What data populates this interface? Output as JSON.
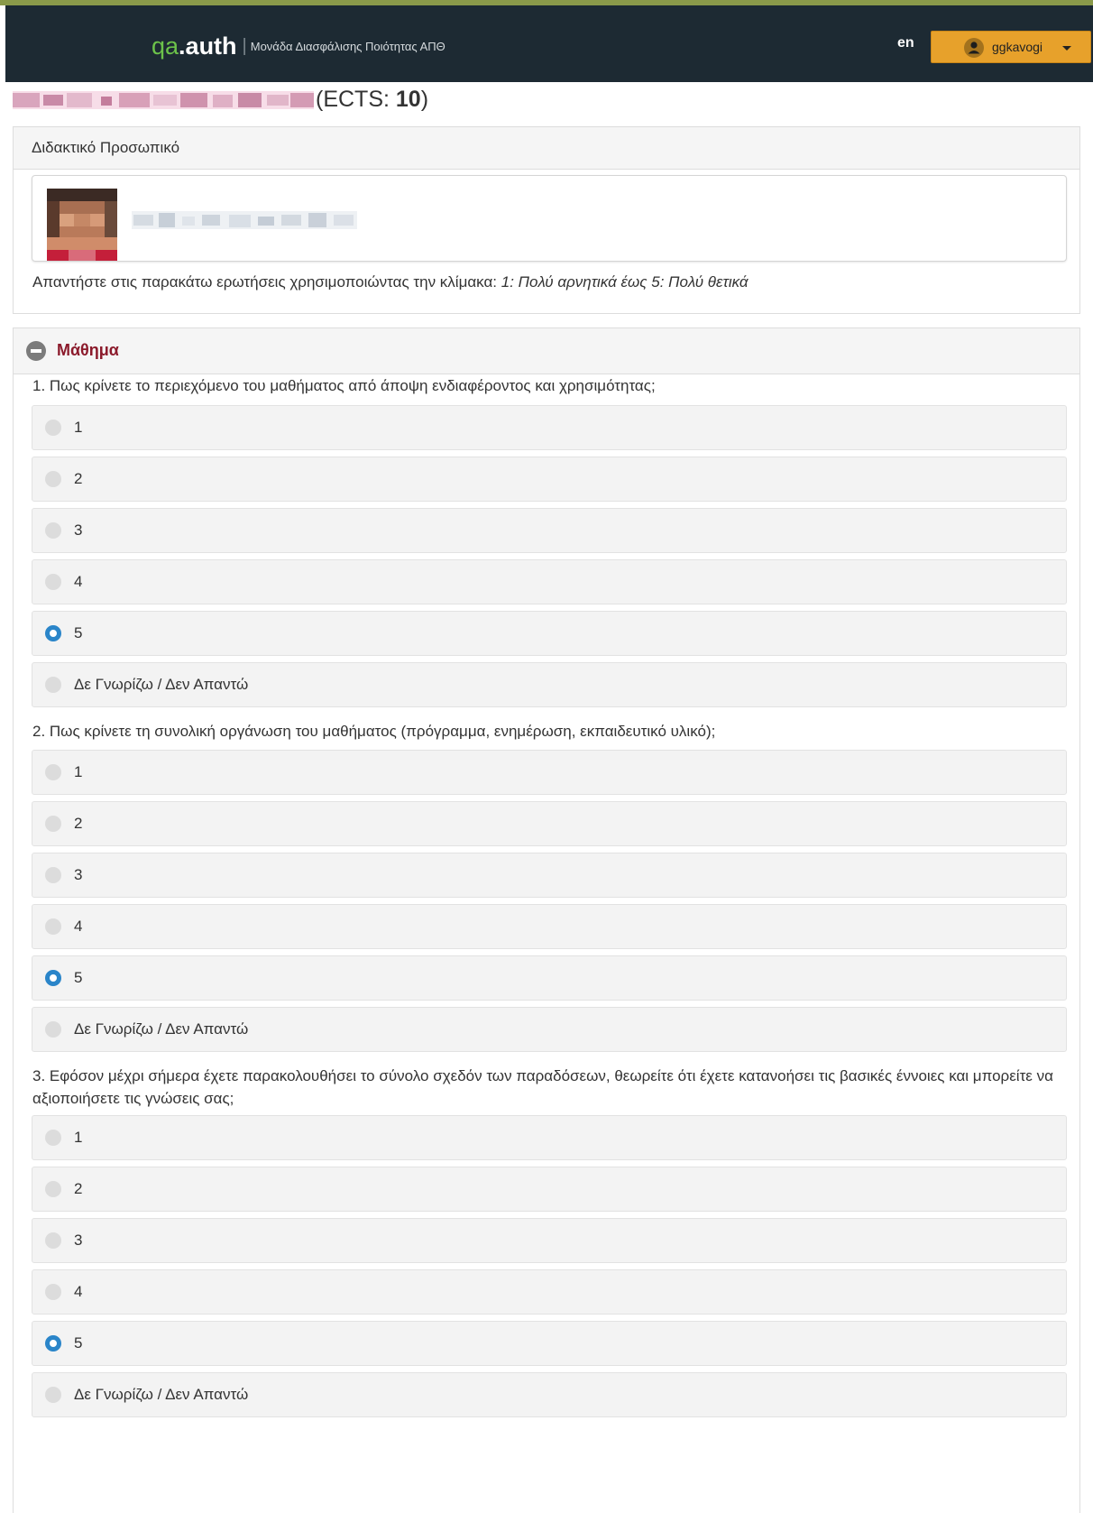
{
  "navbar": {
    "brand_qa": "qa",
    "brand_auth": ".auth",
    "brand_separator": "|",
    "brand_subtitle": "Μονάδα Διασφάλισης Ποιότητας ΑΠΘ",
    "language_link": "en",
    "user_menu": {
      "username": "ggkavogi",
      "icon": "user-icon"
    }
  },
  "course": {
    "ects_prefix": "(ECTS: ",
    "ects_value": "10",
    "ects_suffix": ")"
  },
  "staff_panel": {
    "heading": "Διδακτικό Προσωπικό",
    "instructions_text": "Απαντήστε στις παρακάτω ερωτήσεις χρησιμοποιώντας την κλίμακα: ",
    "instructions_scale": "1: Πολύ αρνητικά έως 5: Πολύ θετικά"
  },
  "section": {
    "title": "Μάθημα",
    "collapse_icon": "minus-circle-icon",
    "accent_color": "#8b1a2b"
  },
  "questions": [
    {
      "text": "1. Πως κρίνετε το περιεχόμενο του μαθήματος από άποψη ενδιαφέροντος και χρησιμότητας;",
      "options": [
        "1",
        "2",
        "3",
        "4",
        "5",
        "Δε Γνωρίζω / Δεν Απαντώ"
      ],
      "selected": "5"
    },
    {
      "text": "2. Πως κρίνετε τη συνολική οργάνωση του μαθήματος (πρόγραμμα, ενημέρωση, εκπαιδευτικό υλικό);",
      "options": [
        "1",
        "2",
        "3",
        "4",
        "5",
        "Δε Γνωρίζω / Δεν Απαντώ"
      ],
      "selected": "5"
    },
    {
      "text": "3. Εφόσον μέχρι σήμερα έχετε παρακολουθήσει το σύνολο σχεδόν των παραδόσεων, θεωρείτε ότι έχετε κατανοήσει τις βασικές έννοιες και μπορείτε να αξιοποιήσετε τις γνώσεις σας;",
      "options": [
        "1",
        "2",
        "3",
        "4",
        "5",
        "Δε Γνωρίζω / Δεν Απαντώ"
      ],
      "selected": "5"
    }
  ],
  "colors": {
    "navbar_bg": "#1d2a33",
    "brand_green": "#6cc24a",
    "user_button": "#e7a12b",
    "radio_checked": "#2a85c9"
  }
}
